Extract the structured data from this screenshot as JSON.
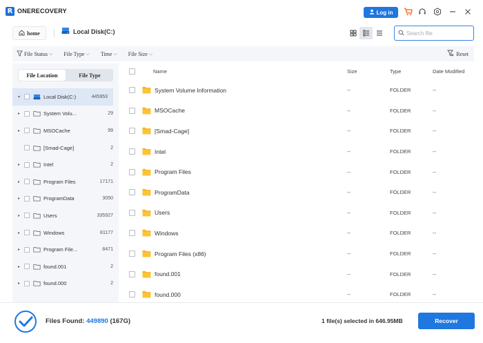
{
  "app": {
    "name": "ONERECOVERY",
    "logo_letter": "R"
  },
  "titlebar": {
    "login_label": "Log in"
  },
  "nav": {
    "home_label": "home",
    "current_path": "Local Disk(C:)",
    "search_placeholder": "Search file"
  },
  "filters": {
    "items": [
      "File Status",
      "File Type",
      "Time",
      "File Size"
    ],
    "reset_label": "Reset"
  },
  "sidebar": {
    "tabs": [
      "File Location",
      "File Type"
    ],
    "active_tab": "File Location",
    "root": {
      "name": "Local Disk(C:)",
      "count": "445953"
    },
    "items": [
      {
        "name": "System Volu...",
        "count": "29",
        "expandable": true
      },
      {
        "name": "MSOCache",
        "count": "99",
        "expandable": true
      },
      {
        "name": "[Smad-Cage]",
        "count": "2",
        "expandable": false
      },
      {
        "name": "Intel",
        "count": "2",
        "expandable": true
      },
      {
        "name": "Program Files",
        "count": "17171",
        "expandable": true
      },
      {
        "name": "ProgramData",
        "count": "3050",
        "expandable": true
      },
      {
        "name": "Users",
        "count": "335927",
        "expandable": true
      },
      {
        "name": "Windows",
        "count": "81177",
        "expandable": true
      },
      {
        "name": "Program File...",
        "count": "8471",
        "expandable": true
      },
      {
        "name": "found.001",
        "count": "2",
        "expandable": true
      },
      {
        "name": "found.000",
        "count": "2",
        "expandable": true
      }
    ]
  },
  "list": {
    "headers": {
      "name": "Name",
      "size": "Size",
      "type": "Type",
      "date": "Date Modified"
    },
    "rows": [
      {
        "name": "System Volume Information",
        "size": "--",
        "type": "FOLDER",
        "date": "--"
      },
      {
        "name": "MSOCache",
        "size": "--",
        "type": "FOLDER",
        "date": "--"
      },
      {
        "name": "[Smad-Cage]",
        "size": "--",
        "type": "FOLDER",
        "date": "--"
      },
      {
        "name": "Intel",
        "size": "--",
        "type": "FOLDER",
        "date": "--"
      },
      {
        "name": "Program Files",
        "size": "--",
        "type": "FOLDER",
        "date": "--"
      },
      {
        "name": "ProgramData",
        "size": "--",
        "type": "FOLDER",
        "date": "--"
      },
      {
        "name": "Users",
        "size": "--",
        "type": "FOLDER",
        "date": "--"
      },
      {
        "name": "Windows",
        "size": "--",
        "type": "FOLDER",
        "date": "--"
      },
      {
        "name": "Program Files (x86)",
        "size": "--",
        "type": "FOLDER",
        "date": "--"
      },
      {
        "name": "found.001",
        "size": "--",
        "type": "FOLDER",
        "date": "--"
      },
      {
        "name": "found.000",
        "size": "--",
        "type": "FOLDER",
        "date": "--"
      }
    ]
  },
  "bottom": {
    "found_label": "Files Found:",
    "found_count": "449890",
    "found_size": "(167G)",
    "selected_text": "1 file(s) selected in 646.95MB",
    "recover_label": "Recover"
  },
  "colors": {
    "accent": "#1f77e0",
    "folder": "#f7b320",
    "sidebar_bg": "#f5f6f9"
  }
}
